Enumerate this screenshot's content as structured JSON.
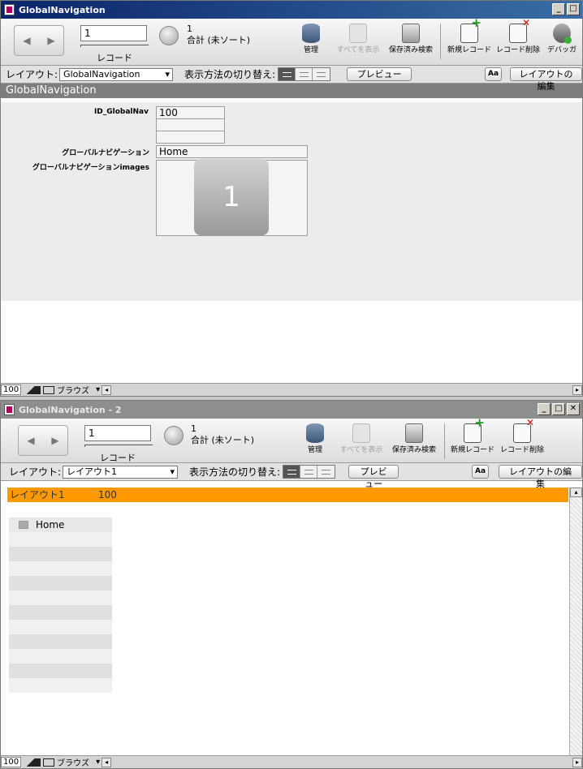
{
  "window1": {
    "title": "GlobalNavigation",
    "win_controls": {
      "minimize": "_",
      "maximize": "□"
    },
    "toolbar": {
      "record_number": "1",
      "record_label": "レコード",
      "found_count": "1",
      "found_status": "合計 (未ソート)",
      "buttons": {
        "manage": "管理",
        "show_all": "すべてを表示",
        "saved_finds": "保存済み検索",
        "new_record": "新規レコード",
        "delete_record": "レコード削除",
        "debugger": "デバッガ"
      }
    },
    "layoutbar": {
      "layout_label": "レイアウト:",
      "layout_value": "GlobalNavigation",
      "view_as_label": "表示方法の切り替え:",
      "preview": "プレビュー",
      "text_format": "Aa",
      "edit_layout": "レイアウトの編集"
    },
    "header": "GlobalNavigation",
    "fields": {
      "id_label": "ID_GlobalNav",
      "id_value": "100",
      "nav_label": "グローバルナビゲーション",
      "nav_value": "Home",
      "images_label": "グローバルナビゲーションimages",
      "image_text": "1"
    },
    "statusbar": {
      "zoom": "100",
      "mode": "ブラウズ"
    }
  },
  "window2": {
    "title": "GlobalNavigation - 2",
    "win_controls": {
      "minimize": "_",
      "maximize": "□",
      "close": "✕"
    },
    "toolbar": {
      "record_number": "1",
      "record_label": "レコード",
      "found_count": "1",
      "found_status": "合計 (未ソート)",
      "buttons": {
        "manage": "管理",
        "show_all": "すべてを表示",
        "saved_finds": "保存済み検索",
        "new_record": "新規レコード",
        "delete_record": "レコード削除"
      }
    },
    "layoutbar": {
      "layout_label": "レイアウト:",
      "layout_value": "レイアウト1",
      "view_as_label": "表示方法の切り替え:",
      "preview": "プレビュー",
      "text_format": "Aa",
      "edit_layout": "レイアウトの編集"
    },
    "header_title": "レイアウト1",
    "header_value": "100",
    "list_first": "Home",
    "statusbar": {
      "zoom": "100",
      "mode": "ブラウズ"
    }
  },
  "colors": {
    "header_orange": "#ff9900",
    "active_title": "#0a246a",
    "inactive_title": "#8e8e8e"
  }
}
